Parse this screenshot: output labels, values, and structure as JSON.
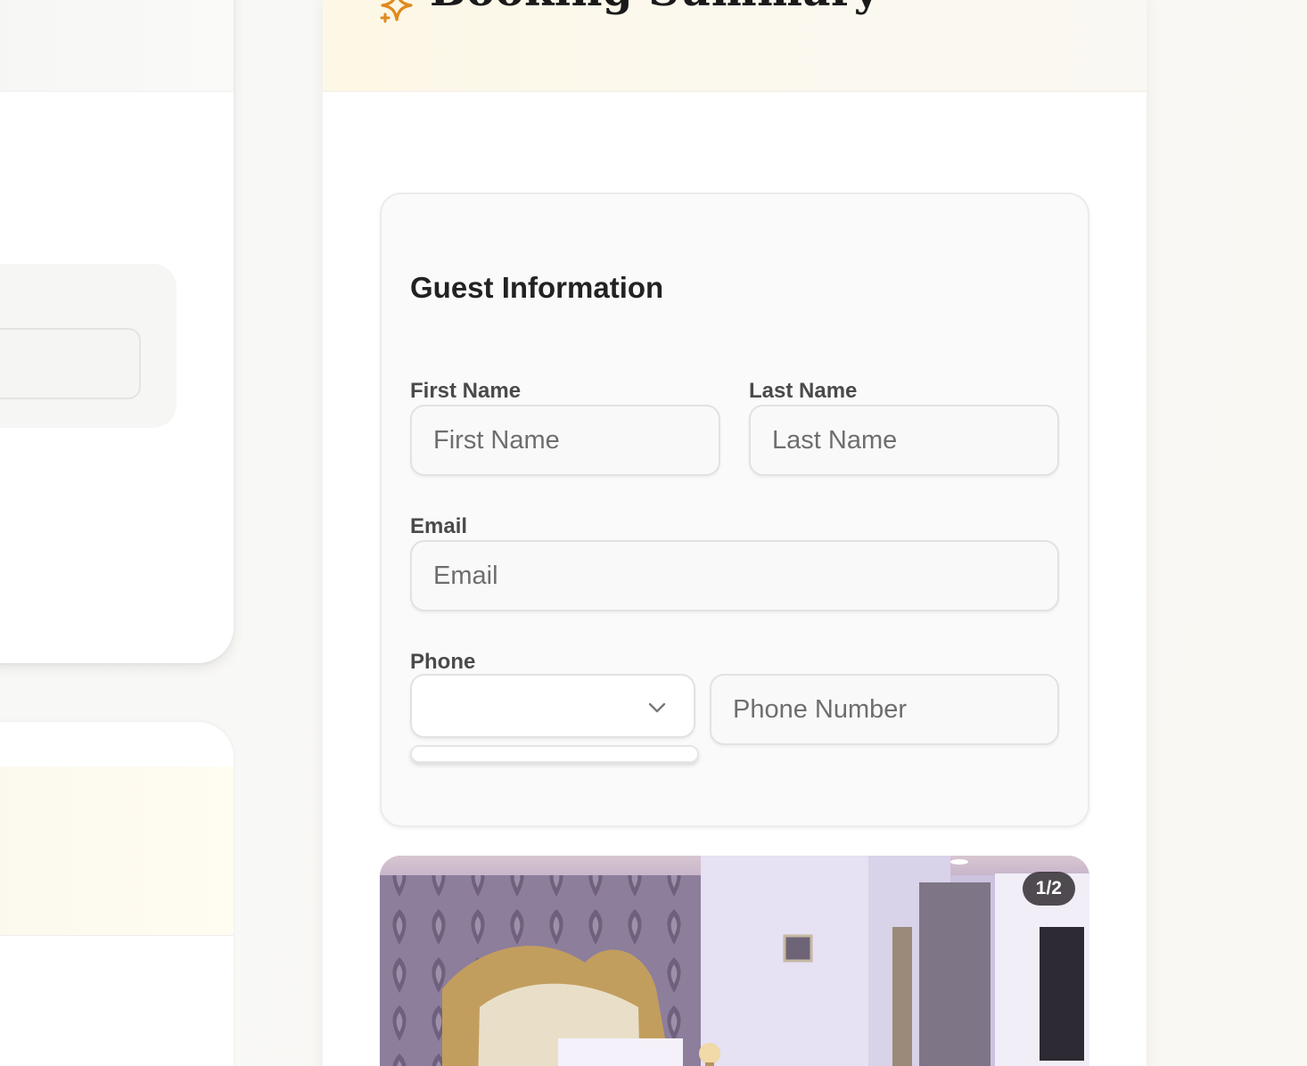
{
  "booking_summary": {
    "title": "Booking Summary",
    "icon": "sparkle-icon",
    "accent_color": "#e08a1e"
  },
  "guest_information": {
    "title": "Guest Information",
    "first_name": {
      "label": "First Name",
      "placeholder": "First Name",
      "value": ""
    },
    "last_name": {
      "label": "Last Name",
      "placeholder": "Last Name",
      "value": ""
    },
    "email": {
      "label": "Email",
      "placeholder": "Email",
      "value": ""
    },
    "phone": {
      "label": "Phone",
      "country_code_value": "",
      "country_code_icon": "chevron-down-icon",
      "number_placeholder": "Phone Number",
      "number_value": ""
    }
  },
  "room_gallery": {
    "counter": "1/2"
  }
}
